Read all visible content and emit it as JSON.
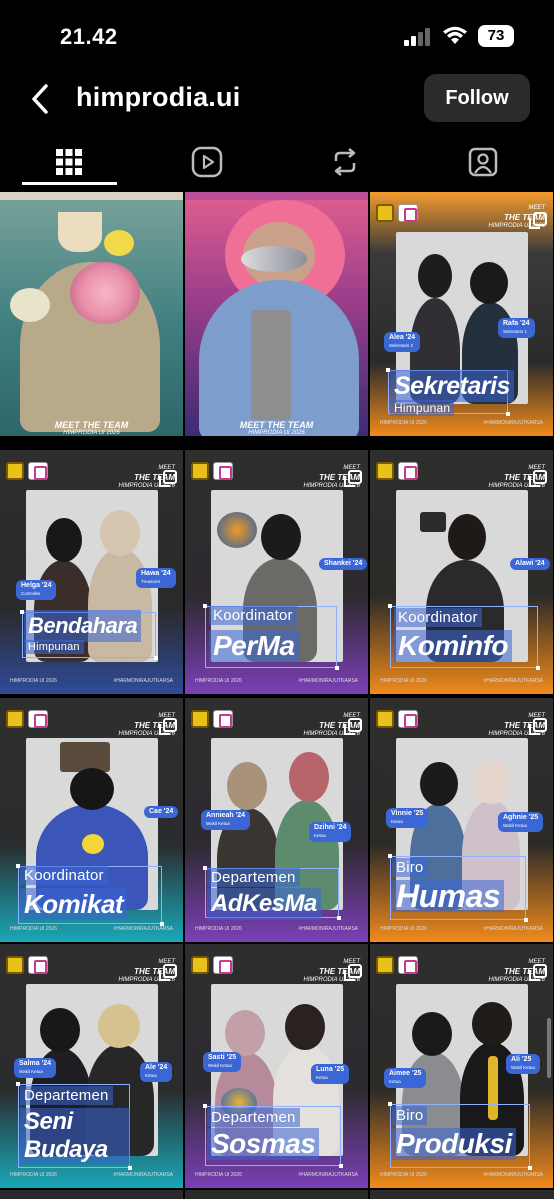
{
  "status_bar": {
    "time": "21.42",
    "battery": "73"
  },
  "header": {
    "username": "himprodia.ui",
    "follow_label": "Follow"
  },
  "tabs": [
    {
      "name": "posts",
      "icon": "grid-icon"
    },
    {
      "name": "reels",
      "icon": "reels-icon"
    },
    {
      "name": "reposts",
      "icon": "repost-icon"
    },
    {
      "name": "tagged",
      "icon": "tagged-icon"
    }
  ],
  "common": {
    "meet": "MEET",
    "the_team": "THE TEAM",
    "himprodia_year": "HIMPRODIA UI 2026",
    "hashtag": "#HARMONIRAJUTKARSA",
    "footer_left": "HIMPRODIA UI 2026"
  },
  "posts": [
    {
      "type": "cover",
      "meet": "MEET",
      "the_team": "THE TEAM",
      "sub": "HIMPRODIA UI 2026"
    },
    {
      "type": "cover",
      "meet": "MEET",
      "the_team": "THE TEAM",
      "sub": "HIMPRODIA UI 2026"
    },
    {
      "type": "team",
      "small": "",
      "big": "Sekretaris",
      "sub2": "Himpunan",
      "tags": [
        {
          "name": "Alea '24",
          "role": "Sekretaris 2"
        },
        {
          "name": "Rafa '24",
          "role": "Sekretaris 1"
        }
      ]
    },
    {
      "type": "team",
      "small": "",
      "big": "Bendahara",
      "sub2": "Himpunan",
      "tags": [
        {
          "name": "Helga '24",
          "role": "Controller"
        },
        {
          "name": "Hawa '24",
          "role": "Treasurer"
        }
      ]
    },
    {
      "type": "team",
      "small": "Koordinator",
      "big": "PerMa",
      "sub2": "",
      "tags": [
        {
          "name": "Shankei '24",
          "role": ""
        }
      ]
    },
    {
      "type": "team",
      "small": "Koordinator",
      "big": "Kominfo",
      "sub2": "",
      "tags": [
        {
          "name": "Alawi '24",
          "role": ""
        }
      ]
    },
    {
      "type": "team",
      "small": "Koordinator",
      "big": "Komikat",
      "sub2": "",
      "tags": [
        {
          "name": "Cae '24",
          "role": ""
        }
      ]
    },
    {
      "type": "team",
      "small": "Departemen",
      "big": "AdKesMa",
      "sub2": "",
      "tags": [
        {
          "name": "Annieah '24",
          "role": "Wakil Ketua"
        },
        {
          "name": "Dzihni '24",
          "role": "Ketua"
        }
      ]
    },
    {
      "type": "team",
      "small": "Biro",
      "big": "Humas",
      "sub2": "",
      "tags": [
        {
          "name": "Vinnie '25",
          "role": "Ketua"
        },
        {
          "name": "Aghnie '25",
          "role": "Wakil Ketua"
        }
      ]
    },
    {
      "type": "team",
      "small": "Departemen",
      "big": "Seni Budaya",
      "sub2": "",
      "tags": [
        {
          "name": "Salma '24",
          "role": "Wakil Ketua"
        },
        {
          "name": "Ale '24",
          "role": "Ketua"
        }
      ]
    },
    {
      "type": "team",
      "small": "Departemen",
      "big": "Sosmas",
      "sub2": "",
      "tags": [
        {
          "name": "Sasti '25",
          "role": "Wakil Ketua"
        },
        {
          "name": "Luna '25",
          "role": "Ketua"
        }
      ]
    },
    {
      "type": "team",
      "small": "Biro",
      "big": "Produksi",
      "sub2": "",
      "tags": [
        {
          "name": "Aimee '25",
          "role": "Ketua"
        },
        {
          "name": "Ali '25",
          "role": "Wakil Ketua"
        }
      ]
    }
  ],
  "colors": {
    "accent": "#3a66d6",
    "orange": "#f08a1c",
    "purple": "#7b3fb7",
    "teal": "#1aa7b8",
    "follow_bg": "#2b2b2b"
  }
}
